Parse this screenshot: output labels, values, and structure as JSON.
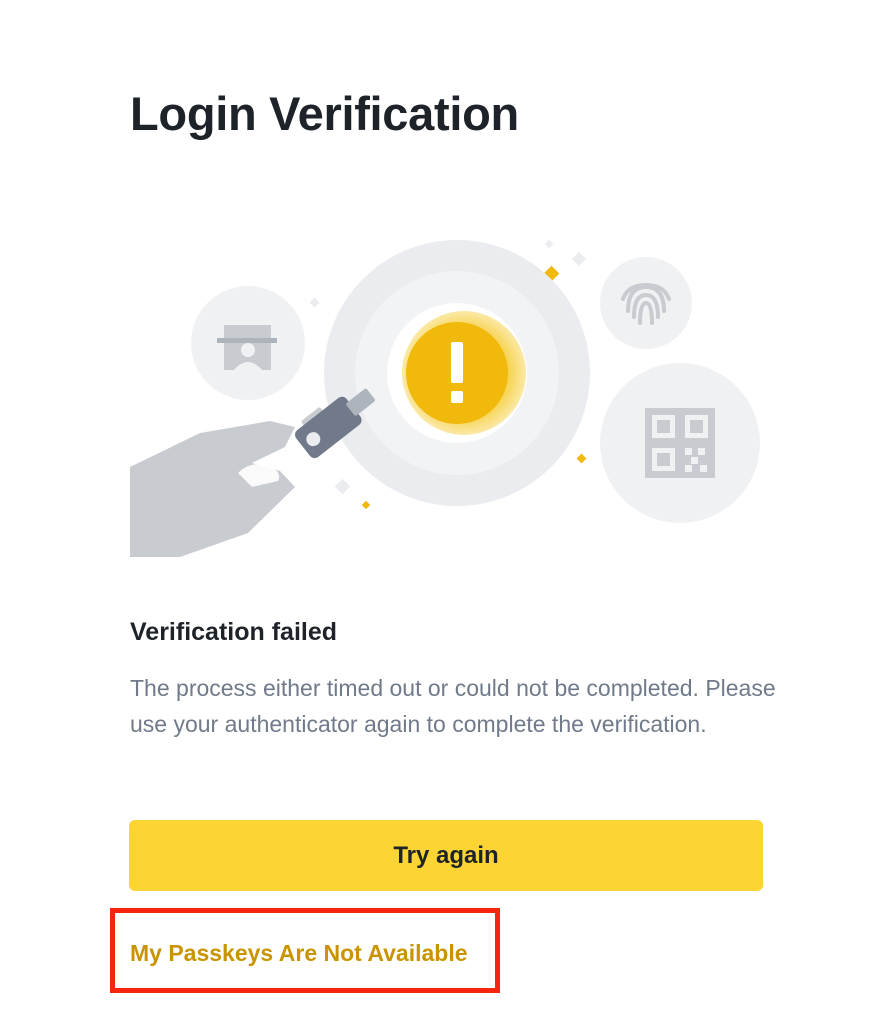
{
  "page": {
    "title": "Login Verification"
  },
  "result": {
    "title": "Verification failed",
    "description": "The process either timed out or could not be completed. Please use your authenticator again to complete the verification."
  },
  "actions": {
    "try_again_label": "Try again",
    "passkeys_unavailable_label": "My Passkeys Are Not Available"
  },
  "illustration": {
    "icons": [
      "security-key-icon",
      "warning-icon",
      "id-card-icon",
      "fingerprint-icon",
      "qr-code-icon",
      "hand-icon"
    ]
  },
  "colors": {
    "primary_yellow": "#fcd535",
    "link_gold": "#c99400",
    "highlight_red": "#f6260e",
    "text_primary": "#1e2329",
    "text_secondary": "#707a8a",
    "illustration_gray": "#c8cbd0"
  }
}
